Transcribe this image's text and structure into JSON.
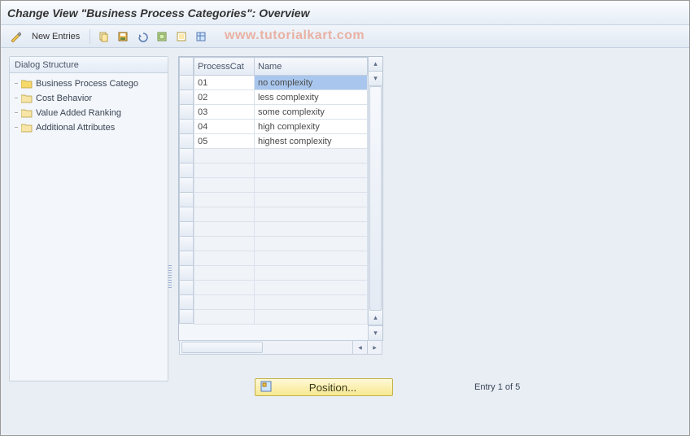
{
  "title": "Change View \"Business Process Categories\": Overview",
  "watermark": "www.tutorialkart.com",
  "toolbar": {
    "new_entries": "New Entries"
  },
  "dialog_structure": {
    "header": "Dialog Structure",
    "items": [
      {
        "label": "Business Process Catego",
        "open": true
      },
      {
        "label": "Cost Behavior",
        "open": false
      },
      {
        "label": "Value Added Ranking",
        "open": false
      },
      {
        "label": "Additional Attributes",
        "open": false
      }
    ]
  },
  "table": {
    "columns": [
      "ProcessCat",
      "Name"
    ],
    "rows": [
      {
        "cat": "01",
        "name": "no complexity",
        "selected": true
      },
      {
        "cat": "02",
        "name": "less complexity",
        "selected": false
      },
      {
        "cat": "03",
        "name": "some complexity",
        "selected": false
      },
      {
        "cat": "04",
        "name": "high complexity",
        "selected": false
      },
      {
        "cat": "05",
        "name": "highest complexity",
        "selected": false
      }
    ],
    "visible_rows": 17
  },
  "footer": {
    "position_label": "Position...",
    "entry_text": "Entry 1 of 5"
  }
}
